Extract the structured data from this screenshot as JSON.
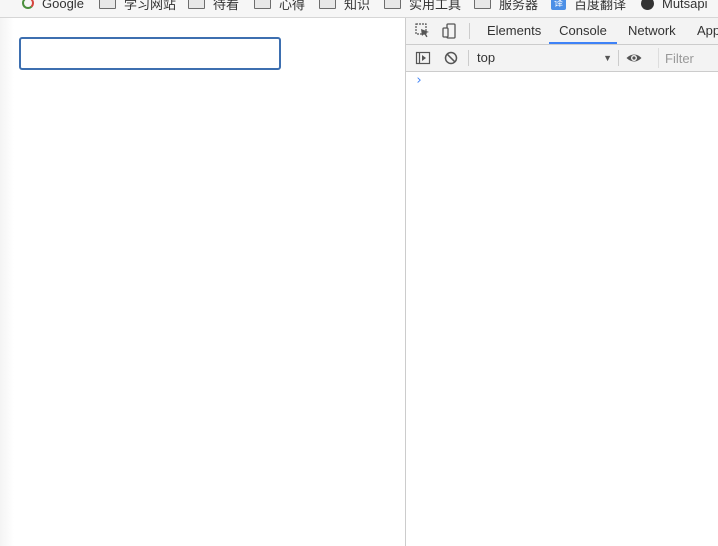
{
  "bookmarks": [
    {
      "label": "Google",
      "icon": "google-icon"
    },
    {
      "label": "学习网站",
      "icon": "folder-icon"
    },
    {
      "label": "待看",
      "icon": "folder-icon"
    },
    {
      "label": "心得",
      "icon": "folder-icon"
    },
    {
      "label": "知识",
      "icon": "folder-icon"
    },
    {
      "label": "实用工具",
      "icon": "folder-icon"
    },
    {
      "label": "服务器",
      "icon": "folder-icon"
    },
    {
      "label": "百度翻译",
      "icon": "translate-icon"
    },
    {
      "label": "Mutsapi",
      "icon": "circle-icon"
    }
  ],
  "page": {
    "input_value": ""
  },
  "devtools": {
    "tabs": [
      {
        "label": "Elements",
        "active": false
      },
      {
        "label": "Console",
        "active": true
      },
      {
        "label": "Network",
        "active": false
      },
      {
        "label": "App",
        "active": false
      }
    ],
    "context": "top",
    "filter_placeholder": "Filter",
    "prompt_symbol": "›",
    "accent_color": "#3e82f7"
  }
}
